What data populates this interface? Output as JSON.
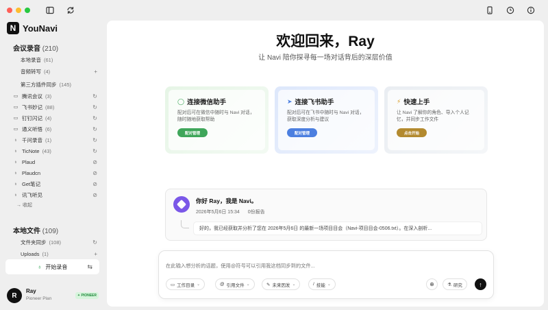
{
  "titlebar": {
    "dot_colors": [
      "#ff5f57",
      "#febc2e",
      "#28c840"
    ],
    "icons": [
      "sidebar-toggle-icon",
      "refresh-icon",
      "phone-icon",
      "add-clock-icon",
      "info-icon"
    ]
  },
  "brand": {
    "logo_letter": "N",
    "name": "YouNavi"
  },
  "sidebar": {
    "meetings": {
      "title": "会议录音",
      "count": "(210)",
      "items": [
        {
          "label": "本地录音",
          "count": "(61)",
          "icon": "",
          "right": ""
        },
        {
          "label": "音频转写",
          "count": "(4)",
          "icon": "",
          "right": "+"
        },
        {
          "label": "第三方插件同步",
          "count": "(145)",
          "icon": "",
          "right": ""
        }
      ],
      "plugins": [
        {
          "label": "腾讯会议",
          "count": "(3)",
          "icon": "video-icon",
          "right": "↻"
        },
        {
          "label": "飞书妙记",
          "count": "(88)",
          "icon": "video-icon",
          "right": "↻"
        },
        {
          "label": "钉钉闪记",
          "count": "(4)",
          "icon": "video-icon",
          "right": "↻"
        },
        {
          "label": "通义听悟",
          "count": "(6)",
          "icon": "video-icon",
          "right": "↻"
        },
        {
          "label": "千问录音",
          "count": "(1)",
          "icon": "mic-icon",
          "right": "↻"
        },
        {
          "label": "TicNote",
          "count": "(43)",
          "icon": "mic-icon",
          "right": "↻"
        },
        {
          "label": "Plaud",
          "count": "",
          "icon": "mic-icon",
          "right": "⊘"
        },
        {
          "label": "Plaudcn",
          "count": "",
          "icon": "mic-icon",
          "right": "⊘"
        },
        {
          "label": "Get笔记",
          "count": "",
          "icon": "mic-icon",
          "right": "⊘"
        },
        {
          "label": "讯飞听见",
          "count": "",
          "icon": "mic-icon",
          "right": "⊘"
        }
      ],
      "collapse_label": "收起"
    },
    "local_files": {
      "title": "本地文件",
      "count": "(109)",
      "items": [
        {
          "label": "文件夹同步",
          "count": "(108)",
          "right": "↻"
        },
        {
          "label": "Uploads",
          "count": "(1)",
          "right": "+"
        }
      ]
    },
    "record_button": "开始录音",
    "user": {
      "avatar_letter": "R",
      "name": "Ray",
      "plan": "Pioneer Plan",
      "badge": "✦ PIONEER"
    }
  },
  "main": {
    "welcome": "欢迎回来，Ray",
    "subtitle": "让 Navi 陪你探寻每一场对话背后的深层价值",
    "cards": [
      {
        "title": "连接微信助手",
        "desc": "配对后可在微信中随时与 Navi 对话，随时随地获取帮助",
        "button": "配对管理",
        "accent": "#3fa65a",
        "icon": "wechat-icon"
      },
      {
        "title": "连接飞书助手",
        "desc": "配对后可在飞书中随时与 Navi 对话，获取深度分析与建议",
        "button": "配对管理",
        "accent": "#4c7fe0",
        "icon": "send-icon"
      },
      {
        "title": "快速上手",
        "desc": "让 Navi 了解你的角色、导入个人记忆，并同步工作文件",
        "button": "点击开始",
        "accent": "#b38a2f",
        "icon": "bolt-icon"
      }
    ],
    "chat": {
      "greeting": "你好 Ray，我是 Navi。",
      "date": "2026年5月6日 15:34",
      "reports": "0份报告",
      "message": "好的，我已经获取并分析了您在 2026年5月6日 的最新一场项目目会（Navi-项目目会-0506.txt）。在深入剖析..."
    },
    "composer": {
      "placeholder": "在此输入想分析的话题，使用@符号可以引用我这档同步到的文件...",
      "chips": [
        "工作目录",
        "引用文件",
        "未来因发",
        "技能"
      ],
      "research": "研究"
    }
  }
}
